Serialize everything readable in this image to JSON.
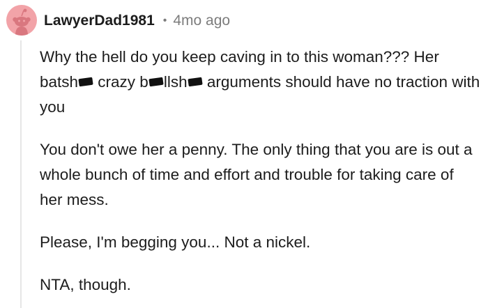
{
  "colors": {
    "avatar_bg": "#f2a3a8",
    "username": "#1c1c1c",
    "meta": "#7c7c7c",
    "text": "#1c1c1c",
    "thread_line": "#e6e6e6"
  },
  "icons": {
    "avatar": "reddit-snoo-avatar-icon"
  },
  "comment": {
    "username": "LawyerDad1981",
    "separator": "•",
    "age": "4mo ago",
    "paragraphs": {
      "p1": {
        "a": "Why the hell do you keep caving in to this woman??? Her batsh",
        "b": " crazy b",
        "c": "llsh",
        "d": " arguments should have no traction with you"
      },
      "p2": "You don't owe her a penny. The only thing that you are is out a whole bunch of time and effort and trouble for taking care of her mess.",
      "p3": "Please, I'm begging you... Not a nickel.",
      "p4": "NTA, though."
    }
  }
}
